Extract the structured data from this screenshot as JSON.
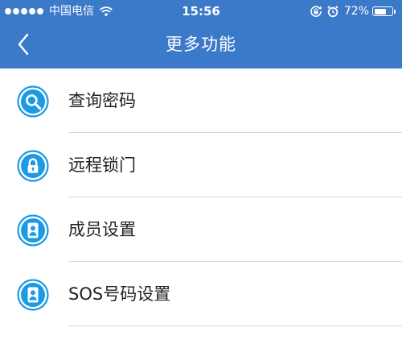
{
  "status_bar": {
    "carrier": "中国电信",
    "time": "15:56",
    "battery_text": "72%",
    "battery_level": 0.72,
    "signal_bars": 5,
    "icons": [
      "signal-dots-icon",
      "wifi-icon",
      "rotation-lock-icon",
      "alarm-icon",
      "battery-icon"
    ]
  },
  "nav": {
    "title": "更多功能",
    "back_icon": "chevron-left-icon"
  },
  "menu": {
    "items": [
      {
        "label": "查询密码",
        "icon": "search-icon"
      },
      {
        "label": "远程锁门",
        "icon": "lock-icon"
      },
      {
        "label": "成员设置",
        "icon": "person-icon"
      },
      {
        "label": "SOS号码设置",
        "icon": "person-icon"
      }
    ]
  },
  "colors": {
    "header_bg": "#3b79c9",
    "icon_blue": "#1c9ae3",
    "text": "#222222",
    "divider": "#d8d8d8"
  }
}
